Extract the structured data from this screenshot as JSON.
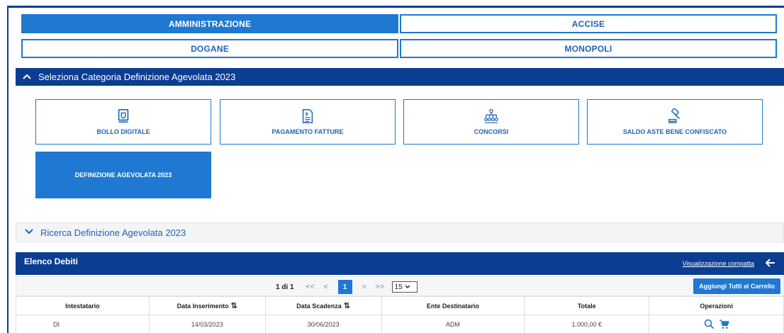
{
  "top_tabs": [
    {
      "label": "AMMINISTRAZIONE",
      "active": true
    },
    {
      "label": "ACCISE",
      "active": false
    },
    {
      "label": "DOGANE",
      "active": false
    },
    {
      "label": "MONOPOLI",
      "active": false
    }
  ],
  "category_section": {
    "title": "Seleziona Categoria Definizione Agevolata 2023",
    "expanded": true
  },
  "categories": [
    {
      "label": "BOLLO DIGITALE",
      "icon": "stamp-icon",
      "active": false
    },
    {
      "label": "PAGAMENTO FATTURE",
      "icon": "invoice-icon",
      "active": false
    },
    {
      "label": "CONCORSI",
      "icon": "org-chart-icon",
      "active": false
    },
    {
      "label": "SALDO ASTE BENE CONFISCATO",
      "icon": "gavel-icon",
      "active": false
    },
    {
      "label": "DEFINIZIONE AGEVOLATA 2023",
      "icon": "",
      "active": true
    }
  ],
  "search_section": {
    "title": "Ricerca Definizione Agevolata 2023",
    "expanded": false
  },
  "debts": {
    "title": "Elenco Debiti",
    "compact_view_link": "Visualizzazione compatta",
    "pagination": {
      "info": "1 di 1",
      "first": "<<",
      "prev": "<",
      "current": "1",
      "next": ">",
      "last": ">>",
      "page_size": "15"
    },
    "add_all_label": "Aggiungi Tutti al Carrello",
    "columns": [
      "Intestatario",
      "Data Inserimento",
      "Data Scadenza",
      "Ente Destinatario",
      "Totale",
      "Operazioni"
    ],
    "rows": [
      {
        "intestatario": "DI",
        "data_inserimento": "14/03/2023",
        "data_scadenza": "30/06/2023",
        "ente": "ADM",
        "totale": "1.000,00 €"
      }
    ]
  },
  "colors": {
    "primary_blue": "#1f78d1",
    "navy": "#0b3d91"
  }
}
